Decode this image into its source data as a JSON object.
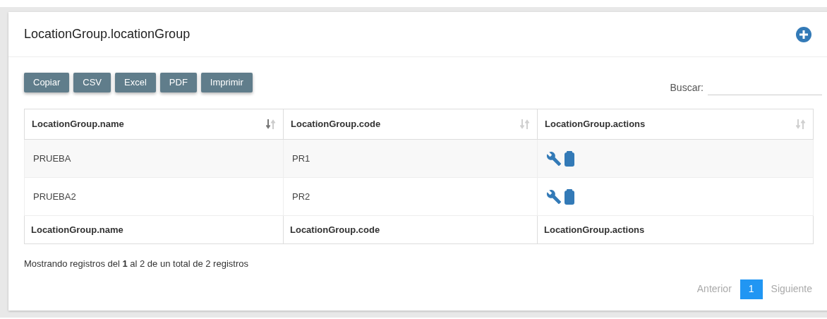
{
  "panel": {
    "title": "LocationGroup.locationGroup"
  },
  "export_buttons": [
    "Copiar",
    "CSV",
    "Excel",
    "PDF",
    "Imprimir"
  ],
  "search": {
    "label": "Buscar:"
  },
  "table": {
    "columns": [
      {
        "label": "LocationGroup.name",
        "sorted": true
      },
      {
        "label": "LocationGroup.code",
        "sorted": false
      },
      {
        "label": "LocationGroup.actions",
        "sorted": false
      }
    ],
    "rows": [
      {
        "name": "PRUEBA",
        "code": "PR1"
      },
      {
        "name": "PRUEBA2",
        "code": "PR2"
      }
    ],
    "footer": [
      "LocationGroup.name",
      "LocationGroup.code",
      "LocationGroup.actions"
    ]
  },
  "info": "Mostrando registros del **1** al 2 de un total de 2 registros",
  "pagination": [
    {
      "label": "Anterior",
      "kind": "nav",
      "disabled": true,
      "selected": false
    },
    {
      "label": "1",
      "kind": "page",
      "disabled": false,
      "selected": true
    },
    {
      "label": "Siguiente",
      "kind": "nav",
      "disabled": true,
      "selected": false
    }
  ]
}
